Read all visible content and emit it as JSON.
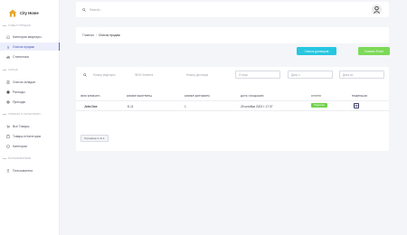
{
  "brand": {
    "name": "City Home"
  },
  "sidebar": {
    "sections": [
      {
        "title": "ОТДЕЛ ПРОДАЖ",
        "items": [
          {
            "label": "Категории квартиры",
            "icon": "home-icon",
            "active": false
          },
          {
            "label": "Список продаж",
            "icon": "dollar-icon",
            "active": true
          },
          {
            "label": "Статистика",
            "icon": "chart-icon",
            "active": false
          }
        ]
      },
      {
        "title": "СКЛАД",
        "items": [
          {
            "label": "Список складов",
            "icon": "list-icon",
            "active": false
          },
          {
            "label": "Расходы",
            "icon": "coins-icon",
            "active": false
          },
          {
            "label": "Приходы",
            "icon": "gear-icon",
            "active": false
          }
        ]
      },
      {
        "title": "ТОВАРЫ И КАТЕГОРИИ",
        "items": [
          {
            "label": "Все Товары",
            "icon": "cart-icon",
            "active": false
          },
          {
            "label": "Товары в Категории",
            "icon": "clipboard-icon",
            "active": false
          },
          {
            "label": "Категории",
            "icon": "cube-icon",
            "active": false
          }
        ]
      },
      {
        "title": "ПОЛЬЗОВАТЕЛИ",
        "items": [
          {
            "label": "Пользователи",
            "icon": "user-icon",
            "active": false
          }
        ]
      }
    ]
  },
  "topbar": {
    "search_placeholder": "Search..."
  },
  "breadcrumb": {
    "home": "Главная",
    "separator": "/",
    "current": "Список продаж"
  },
  "actions": {
    "add_contract": "Список договоров",
    "export_excel": "Скачать Excel"
  },
  "filters": {
    "apartment_number": "Номер квартиры",
    "client_name": "ФИО Клиента",
    "contract_number": "Номер договора",
    "status": "Статус",
    "date_from": "Дата с",
    "date_to": "Дата по"
  },
  "table": {
    "headers": [
      "ФИО КЛИЕНТА",
      "НОМЕР КВАРТИРЫ",
      "НОМЕР ДОГОВОРА",
      "ДАТА СОЗДАНИЯ",
      "СТАТУС",
      "ПОДРОБНО"
    ],
    "rows": [
      {
        "client": "John Doe",
        "apartment": "Б-11",
        "contract": "1",
        "created": "25 октября 2023 г. 17:37",
        "status": "Подписан"
      }
    ]
  },
  "pagination": {
    "label": "Страница 1 из 1"
  },
  "colors": {
    "accent": "#5b6bd6",
    "add_button": "#27c6e1",
    "excel_button": "#7cd957",
    "status_signed": "#6fd34b"
  }
}
